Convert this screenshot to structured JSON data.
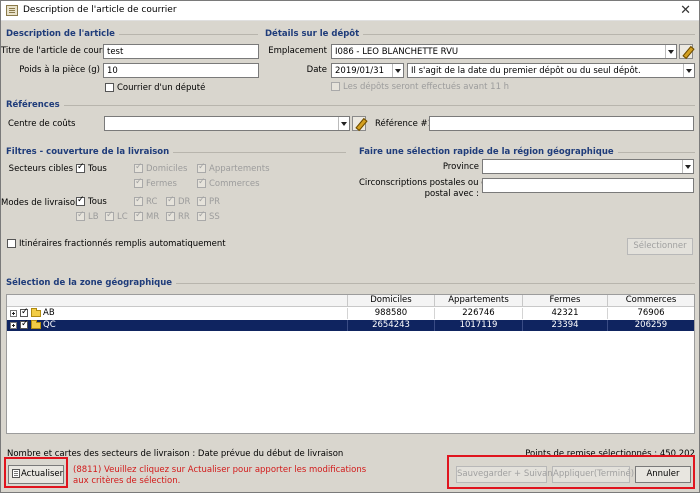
{
  "window": {
    "title": "Description de l'article de courrier",
    "close_glyph": "✕"
  },
  "article": {
    "section": "Description de l'article",
    "title_label": "Titre de l'article de courrier",
    "title_value": "test",
    "weight_label": "Poids à la pièce (g)",
    "weight_value": "10",
    "deputy_label": "Courrier d'un député"
  },
  "deposit": {
    "section": "Détails sur le dépôt",
    "location_label": "Emplacement",
    "location_value": "I086 - LEO BLANCHETTE RVU",
    "date_label": "Date",
    "date_value": "2019/01/31",
    "date_option": "Il s'agit de la date du premier dépôt ou du seul dépôt.",
    "before_11_label": "Les dépôts seront effectués avant 11 h"
  },
  "references": {
    "section": "Références",
    "cost_center_label": "Centre de coûts",
    "cost_center_value": "",
    "ref1_label": "Référence #1",
    "ref1_value": ""
  },
  "filters": {
    "section": "Filtres - couverture de la livraison",
    "target_sectors_label": "Secteurs cibles",
    "all_label": "Tous",
    "sectors": [
      "Domiciles",
      "Appartements",
      "Fermes",
      "Commerces"
    ],
    "delivery_modes_label": "Modes de livraison",
    "modes": [
      "RC",
      "DR",
      "PR",
      "LB",
      "LC",
      "MR",
      "RR",
      "SS"
    ],
    "auto_itineraries_label": "Itinéraires fractionnés remplis automatiquement"
  },
  "quick_select": {
    "section": "Faire une sélection rapide de la région géographique",
    "province_label": "Province",
    "province_value": "",
    "postal_label_line1": "Circonscriptions postales ou code",
    "postal_label_line2": "postal avec :",
    "postal_value": "",
    "select_button": "Sélectionner"
  },
  "zone": {
    "section": "Sélection de la zone géographique",
    "columns": [
      "Domiciles",
      "Appartements",
      "Fermes",
      "Commerces"
    ],
    "rows": [
      {
        "name": "AB",
        "values": [
          "988580",
          "226746",
          "42321",
          "76906"
        ],
        "selected": false
      },
      {
        "name": "QC",
        "values": [
          "2654243",
          "1017119",
          "23394",
          "206259"
        ],
        "selected": true
      }
    ]
  },
  "footer": {
    "stats_text": "Nombre et cartes des secteurs de livraison : Date prévue du début de livraison",
    "points_text": "Points de remise sélectionnés : 450 202",
    "refresh_button": "Actualiser",
    "warning": "(8811) Veuillez cliquez sur Actualiser pour apporter les modifications aux critères de sélection.",
    "save_next_button": "Sauvegarder + Suivant",
    "apply_button": "Appliquer(Terminé)",
    "cancel_button": "Annuler"
  },
  "colors": {
    "highlight_red": "#e0141e",
    "section_blue": "#1f3c7a",
    "selected_row": "#0f2460"
  }
}
